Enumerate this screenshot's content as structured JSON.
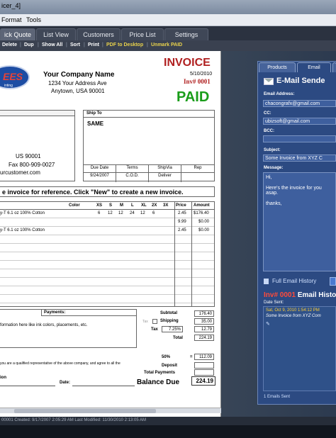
{
  "window": {
    "title": "icer_4]"
  },
  "menu": {
    "items": [
      "Format",
      "Tools"
    ]
  },
  "tabs": [
    "ick Quote",
    "List View",
    "Customers",
    "Price List",
    "Settings"
  ],
  "toolbar": {
    "items": [
      "Delete",
      "Dup",
      "Show All",
      "Sort",
      "Print",
      "PDF to Desktop",
      "Unmark PAID"
    ],
    "separator": "|"
  },
  "logo": {
    "text": "EES",
    "tagline": "inting"
  },
  "company": {
    "name": "Your Company Name",
    "address": "1234 Your Address Ave",
    "city": "Anytown, USA 90001"
  },
  "invoice": {
    "title": "INVOICE",
    "date": "5/10/2010",
    "number": "Inv# 0001",
    "status": "PAID"
  },
  "bill_to": {
    "zip": "US   90001",
    "fax": "Fax 800-909-0027",
    "web": "urcustomer.com"
  },
  "ship_to": {
    "header": "Ship To",
    "value": "SAME",
    "columns": [
      "Due Date",
      "Terms",
      "ShipVia",
      "Rep"
    ],
    "values": [
      "9/24/2007",
      "C.O.D.",
      "Deliver",
      ""
    ]
  },
  "banner": "e invoice for reference. Click \"New\" to create a new invoice.",
  "items": {
    "headers": [
      "Color",
      "XS",
      "S",
      "M",
      "L",
      "XL",
      "2X",
      "3X",
      "Price",
      "Amount"
    ],
    "rows": [
      {
        "desc": "y-T 6.1 oz 100% Cotton",
        "xs": "6",
        "s": "12",
        "m": "12",
        "l": "24",
        "xl": "12",
        "x2": "6",
        "price": "2.45",
        "amount": "$176.40"
      },
      {
        "desc": "",
        "xs": "",
        "s": "",
        "m": "",
        "l": "",
        "xl": "",
        "x2": "",
        "price": "9.99",
        "amount": "$0.00"
      },
      {
        "desc": "y-T 6.1 oz 100% Cotton",
        "xs": "",
        "s": "",
        "m": "",
        "l": "",
        "xl": "",
        "x2": "",
        "price": "2.45",
        "amount": "$0.00"
      }
    ]
  },
  "payments": {
    "header": "Payments:",
    "note": "formation here like ink colors, placements, etc."
  },
  "totals": {
    "subtotal_label": "Subtotal",
    "subtotal": "176.40",
    "tax_label_small": "Tax",
    "shipping_label": "Shipping",
    "shipping": "35.00",
    "tax_label": "Tax",
    "tax_rate": "7.25%",
    "tax": "12.79",
    "total_label": "Total",
    "total": "224.19",
    "deposit_pct": "50%",
    "deposit_eq": "=",
    "deposit_amount": "112.09",
    "deposit_label": "Deposit",
    "total_payments_label": "Total Payments",
    "balance_label": "Balance Due",
    "balance": "224.19"
  },
  "signature": {
    "text1": "you are a qualified representative of the above company, and agree to all the",
    "text2": "ion",
    "date_label": "Date:"
  },
  "status_bar": "00001 Created: 9/17/2007 2:05:29 AM Last Modified: 11/30/2010 2:13:05 AM",
  "email": {
    "tabs": [
      "Products",
      "Email"
    ],
    "title": "E-Mail Sende",
    "from_label": "Email Address:",
    "from": "chacongrafx@gmail.com",
    "cc_label": "CC:",
    "cc": "ubizsoft@gmail.com",
    "bcc_label": "BCC:",
    "bcc": "",
    "subject_label": "Subject:",
    "subject": "Some Invoice from XYZ C",
    "message_label": "Message:",
    "message": [
      "Hi,",
      "Here's the invoice for you",
      "asap.",
      "thanks,"
    ],
    "history_link": "Full Email History",
    "history_title_num": "Inv# 0001",
    "history_title": "Email Histo",
    "history_sub": "Date Sent:",
    "history_date": "Sat, Oct 9, 2010 1:54:12 PM",
    "history_subject": "Some Invoice from XYZ Com",
    "emails_sent": "1 Emails Sent"
  }
}
